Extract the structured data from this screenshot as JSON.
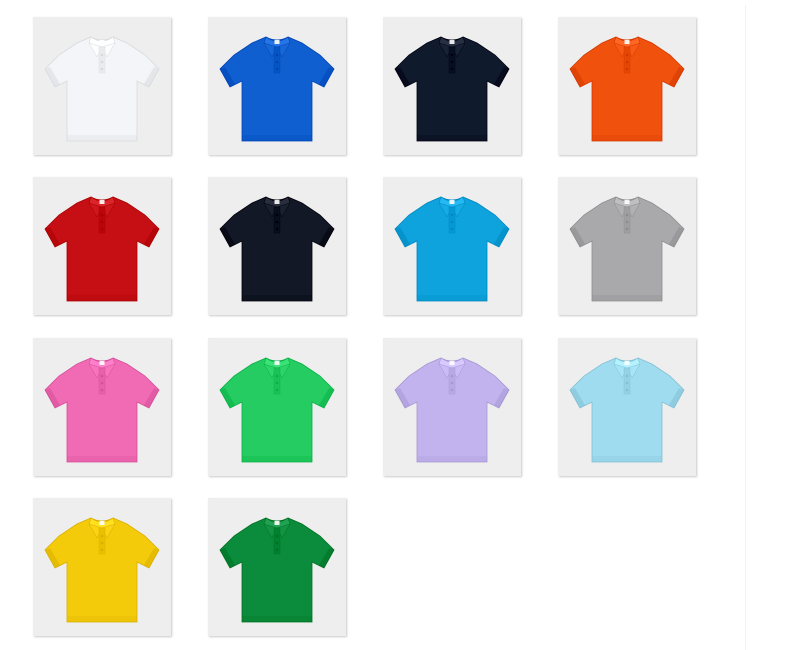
{
  "gallery": {
    "items": [
      {
        "name": "white",
        "color": "#f3f5f8"
      },
      {
        "name": "royal-blue",
        "color": "#0f5fd0"
      },
      {
        "name": "navy",
        "color": "#101a2d"
      },
      {
        "name": "orange",
        "color": "#f0520e"
      },
      {
        "name": "red",
        "color": "#c50f14"
      },
      {
        "name": "black-navy",
        "color": "#121826"
      },
      {
        "name": "sky-blue",
        "color": "#0ea3dc"
      },
      {
        "name": "heather-grey",
        "color": "#a9a9ab"
      },
      {
        "name": "pink",
        "color": "#f06ab4"
      },
      {
        "name": "green",
        "color": "#24cc61"
      },
      {
        "name": "lavender",
        "color": "#c2b3ee"
      },
      {
        "name": "light-blue",
        "color": "#9fdcef"
      },
      {
        "name": "yellow",
        "color": "#f4cb0b"
      },
      {
        "name": "forest-green",
        "color": "#0b8c3c"
      }
    ]
  }
}
